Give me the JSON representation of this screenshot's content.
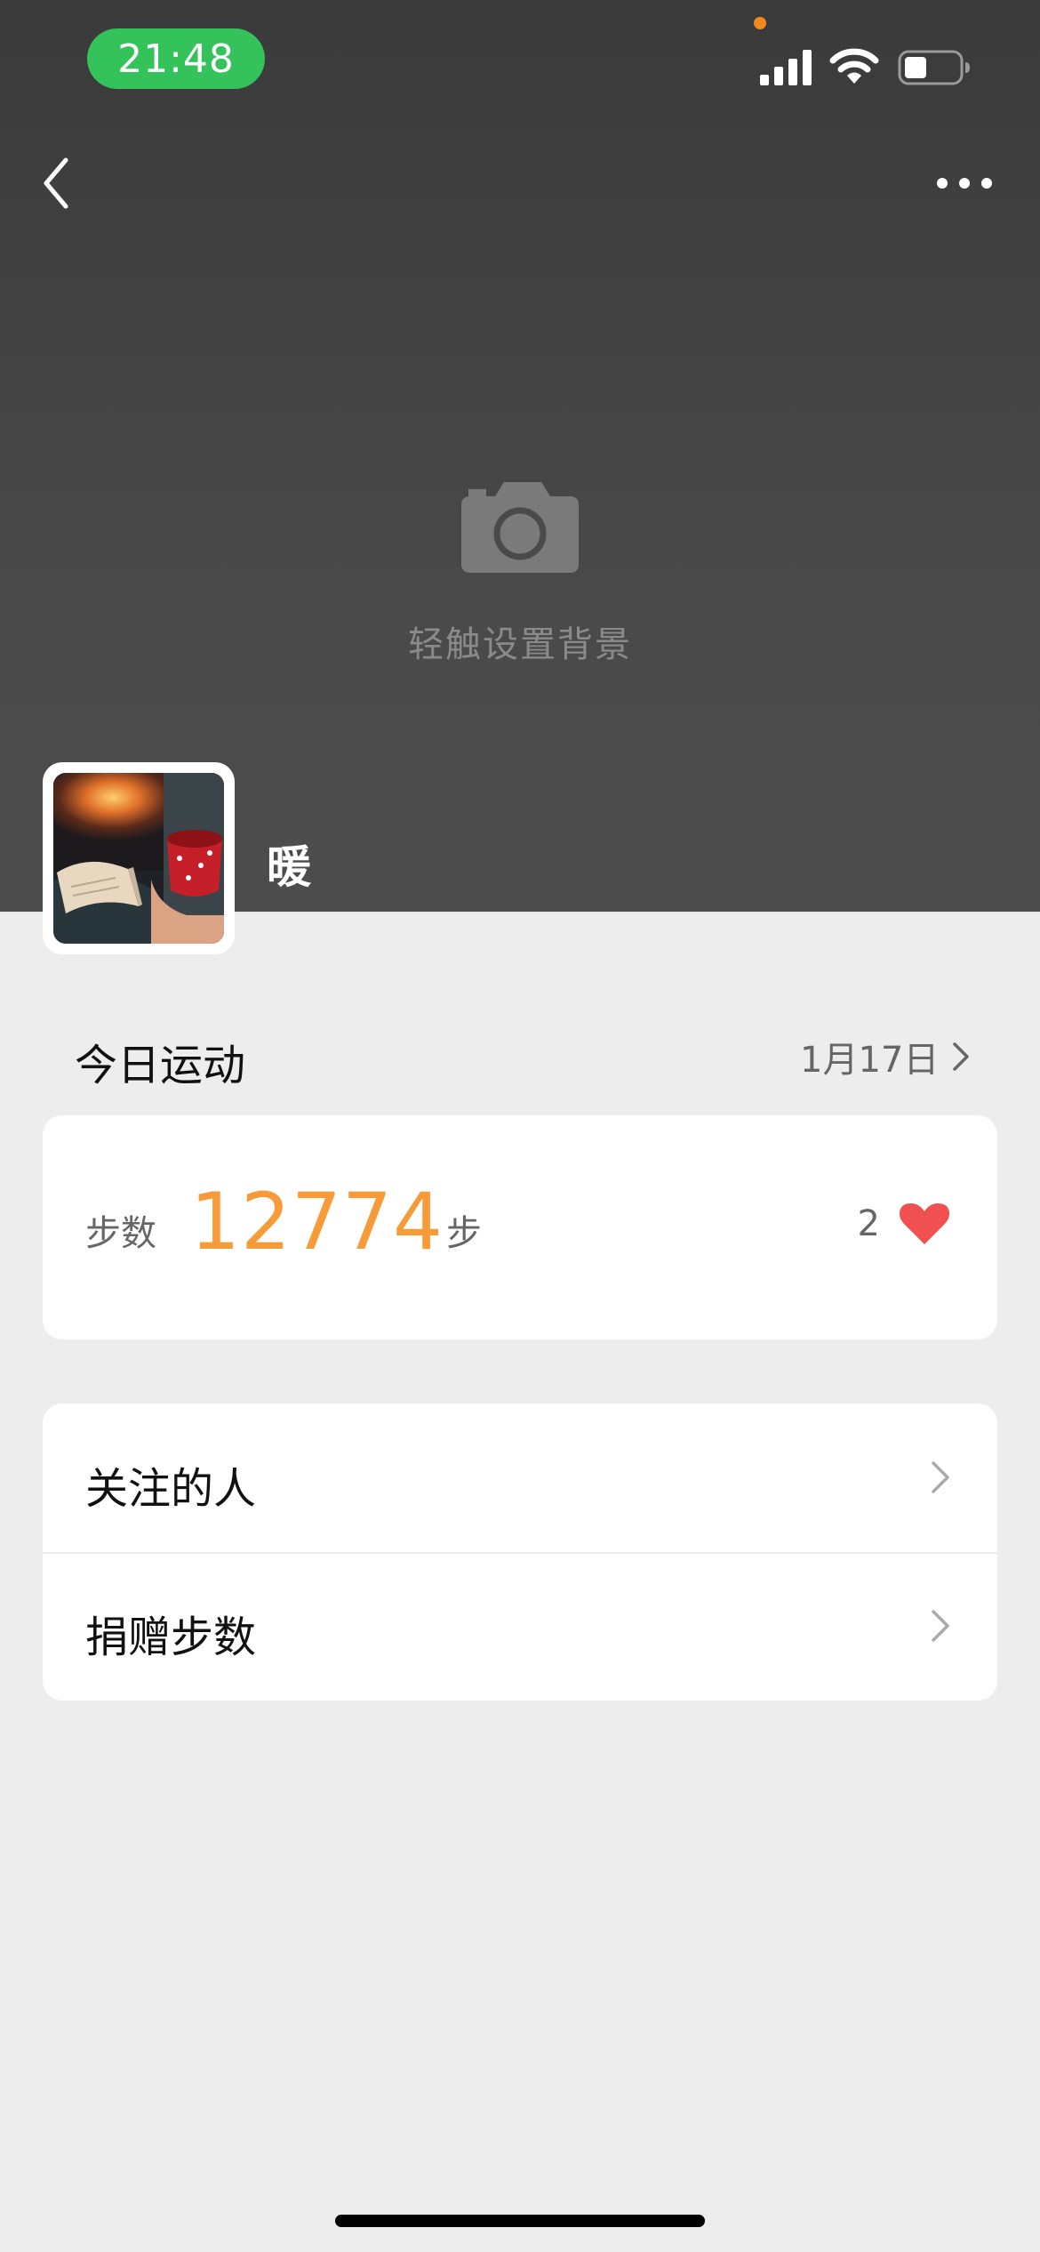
{
  "status_bar": {
    "time": "21:48"
  },
  "header": {
    "set_background_label": "轻触设置背景",
    "username": "暖"
  },
  "today": {
    "title": "今日运动",
    "date": "1月17日",
    "steps_label": "步数",
    "steps_value": "12774",
    "steps_unit": "步",
    "likes_count": "2"
  },
  "menu": {
    "items": [
      {
        "label": "关注的人"
      },
      {
        "label": "捐赠步数"
      }
    ]
  },
  "colors": {
    "accent_orange": "#f79a38",
    "heart_red": "#f05050",
    "status_green": "#33c35a"
  }
}
